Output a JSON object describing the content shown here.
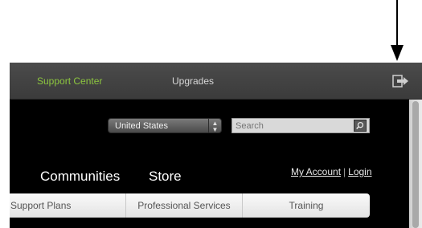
{
  "topbar": {
    "support_center": "Support Center",
    "upgrades": "Upgrades"
  },
  "header": {
    "country": "United States",
    "search_placeholder": "Search"
  },
  "main_nav": {
    "communities": "Communities",
    "store": "Store"
  },
  "account": {
    "my_account": "My Account",
    "separator": "|",
    "login": "Login"
  },
  "tabs": [
    {
      "label": "Support Plans"
    },
    {
      "label": "Professional Services"
    },
    {
      "label": "Training"
    }
  ],
  "icons": {
    "exit": "exit-icon",
    "search": "search-icon",
    "select_arrows": "up-down-arrows-icon",
    "annotation_arrow": "arrow-down-icon"
  },
  "colors": {
    "accent_green": "#8dc63f",
    "topbar": "#444444",
    "background": "#000000"
  }
}
